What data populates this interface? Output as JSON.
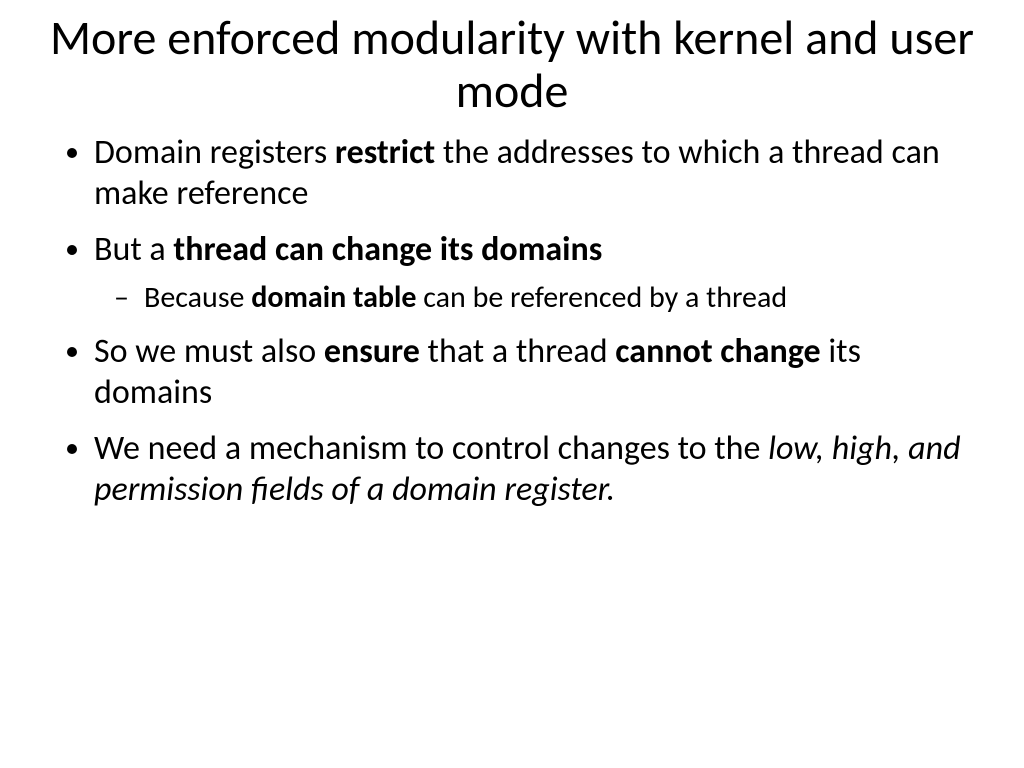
{
  "title": "More enforced modularity with kernel and user mode",
  "bullets": {
    "b1": {
      "pre": "Domain registers ",
      "bold": "restrict",
      "post": " the addresses to which a thread can make reference"
    },
    "b2": {
      "pre": "But a ",
      "bold": "thread can change its domains",
      "sub": {
        "pre": "Because ",
        "bold": "domain table",
        "post": " can be referenced by a thread"
      }
    },
    "b3": {
      "pre": "So we must also ",
      "bold1": "ensure",
      "mid": " that a thread ",
      "bold2": "cannot change",
      "post": " its domains"
    },
    "b4": {
      "pre": "We need a mechanism to control changes to the ",
      "italic": "low, high, and permission fields of a domain register."
    }
  }
}
